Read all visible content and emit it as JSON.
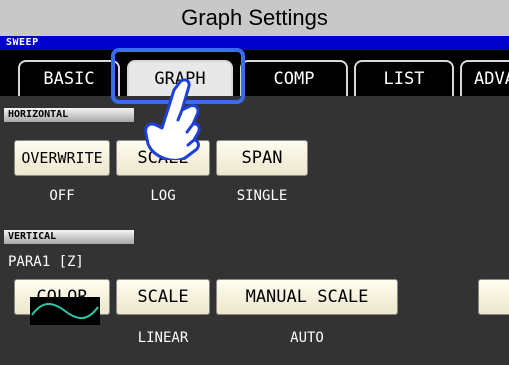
{
  "window": {
    "title": "Graph Settings"
  },
  "sweep": {
    "label": "SWEEP"
  },
  "tabs": [
    {
      "label": "BASIC"
    },
    {
      "label": "GRAPH"
    },
    {
      "label": "COMP"
    },
    {
      "label": "LIST"
    },
    {
      "label": "ADVA"
    }
  ],
  "horizontal": {
    "section_label": "HORIZONTAL",
    "overwrite": {
      "label": "OVERWRITE",
      "value": "OFF"
    },
    "scale": {
      "label": "SCALE",
      "value": "LOG"
    },
    "span": {
      "label": "SPAN",
      "value": "SINGLE"
    }
  },
  "vertical": {
    "section_label": "VERTICAL",
    "para": "PARA1 [Z]",
    "color": {
      "label": "COLOR"
    },
    "scale": {
      "label": "SCALE",
      "value": "LINEAR"
    },
    "manual_scale": {
      "label": "MANUAL SCALE",
      "value": "AUTO"
    }
  },
  "colors": {
    "sweep_bar": "#0000cc",
    "trace": "#2ec4a8",
    "highlight": "#3a6cf0"
  },
  "icons": {
    "pointer": "hand-pointer-icon",
    "trace_sample": "wave-icon"
  }
}
